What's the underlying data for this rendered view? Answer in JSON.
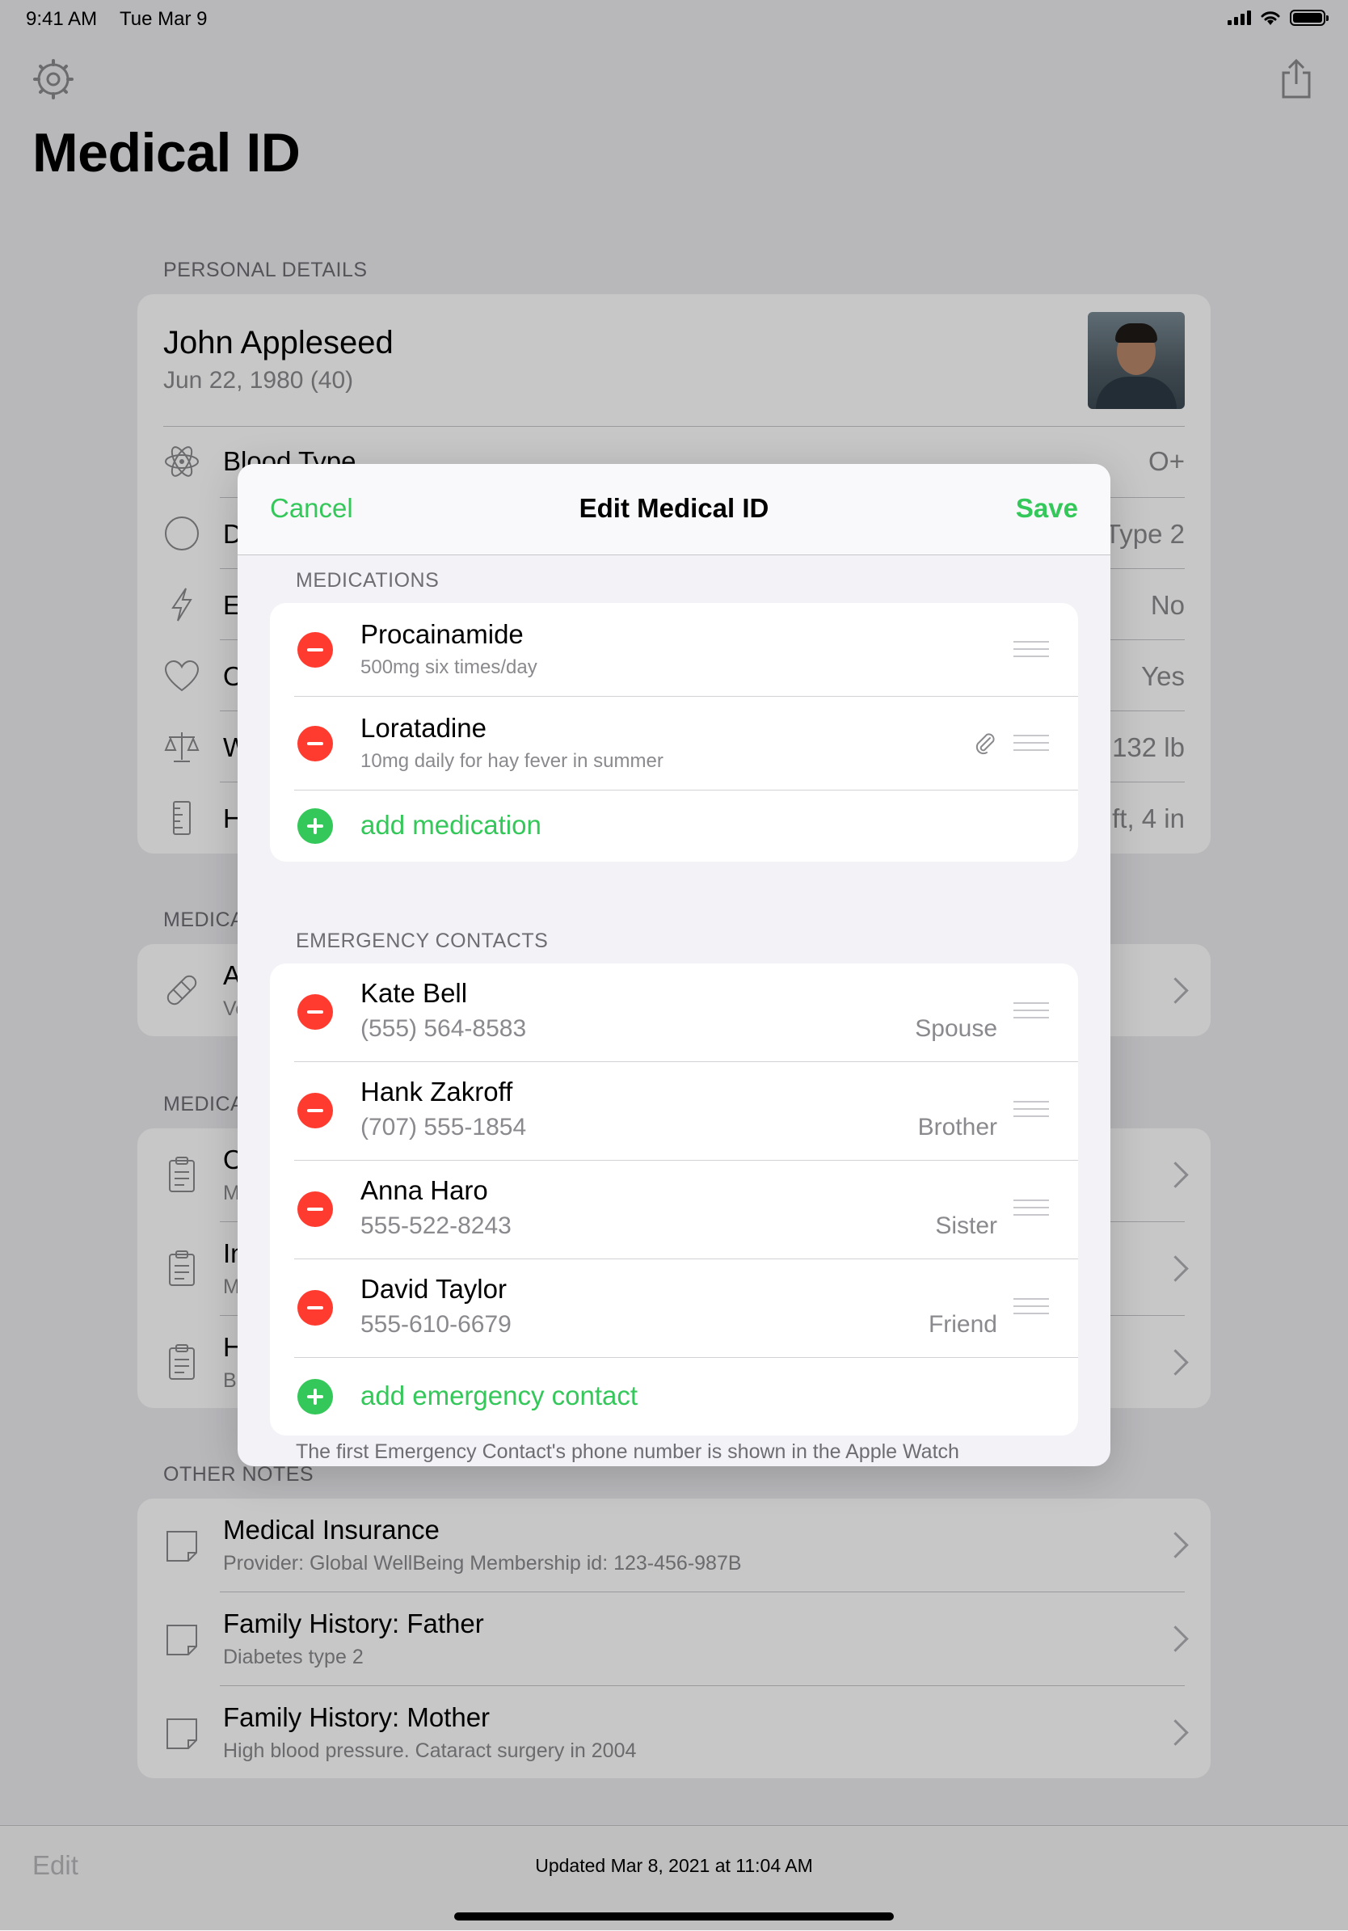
{
  "status_bar": {
    "time": "9:41 AM",
    "date": "Tue Mar 9"
  },
  "page": {
    "title": "Medical ID"
  },
  "personal_details": {
    "section_label": "PERSONAL DETAILS",
    "name": "John Appleseed",
    "dob": "Jun 22, 1980 (40)",
    "rows": [
      {
        "icon": "atom-icon",
        "label": "Blood Type",
        "value": "O+"
      },
      {
        "icon": "circle-icon",
        "label": "D",
        "value": "Type 2"
      },
      {
        "icon": "bolt-icon",
        "label": "E",
        "value": "No"
      },
      {
        "icon": "heart-icon",
        "label": "O",
        "value": "Yes"
      },
      {
        "icon": "scale-icon",
        "label": "W",
        "value": "132 lb"
      },
      {
        "icon": "ruler-icon",
        "label": "H",
        "value": "ft, 4 in"
      }
    ]
  },
  "medications_bg": {
    "section_label": "MEDICA",
    "row": {
      "label": "A",
      "sub": "Ve"
    }
  },
  "medical_bg": {
    "section_label": "MEDICA",
    "rows": [
      {
        "label": "O",
        "sub": "M"
      },
      {
        "label": "In",
        "sub": "M"
      },
      {
        "label": "H",
        "sub": "B"
      }
    ]
  },
  "other_notes": {
    "section_label": "OTHER NOTES",
    "rows": [
      {
        "title": "Medical Insurance",
        "sub": "Provider: Global WellBeing Membership id: 123-456-987B"
      },
      {
        "title": "Family History: Father",
        "sub": "Diabetes type 2"
      },
      {
        "title": "Family History: Mother",
        "sub": "High blood pressure. Cataract surgery in 2004"
      }
    ]
  },
  "bottom_bar": {
    "edit_label": "Edit",
    "updated": "Updated Mar 8, 2021 at 11:04 AM"
  },
  "modal": {
    "cancel": "Cancel",
    "title": "Edit Medical ID",
    "save": "Save",
    "medications_label": "MEDICATIONS",
    "medications": [
      {
        "name": "Procainamide",
        "detail": "500mg six times/day",
        "has_attachment": false
      },
      {
        "name": "Loratadine",
        "detail": "10mg daily for hay fever in summer",
        "has_attachment": true
      }
    ],
    "add_medication": "add medication",
    "contacts_label": "EMERGENCY CONTACTS",
    "contacts": [
      {
        "name": "Kate Bell",
        "phone": "(555) 564-8583",
        "relation": "Spouse"
      },
      {
        "name": "Hank Zakroff",
        "phone": "(707) 555-1854",
        "relation": "Brother"
      },
      {
        "name": "Anna Haro",
        "phone": "555-522-8243",
        "relation": "Sister"
      },
      {
        "name": "David Taylor",
        "phone": "555-610-6679",
        "relation": "Friend"
      }
    ],
    "add_contact": "add emergency contact",
    "footnote": "The first Emergency Contact's phone number is shown in the Apple Watch"
  },
  "colors": {
    "accent": "#34c759",
    "destructive": "#ff3b30",
    "secondary_text": "#8a8a8e"
  }
}
